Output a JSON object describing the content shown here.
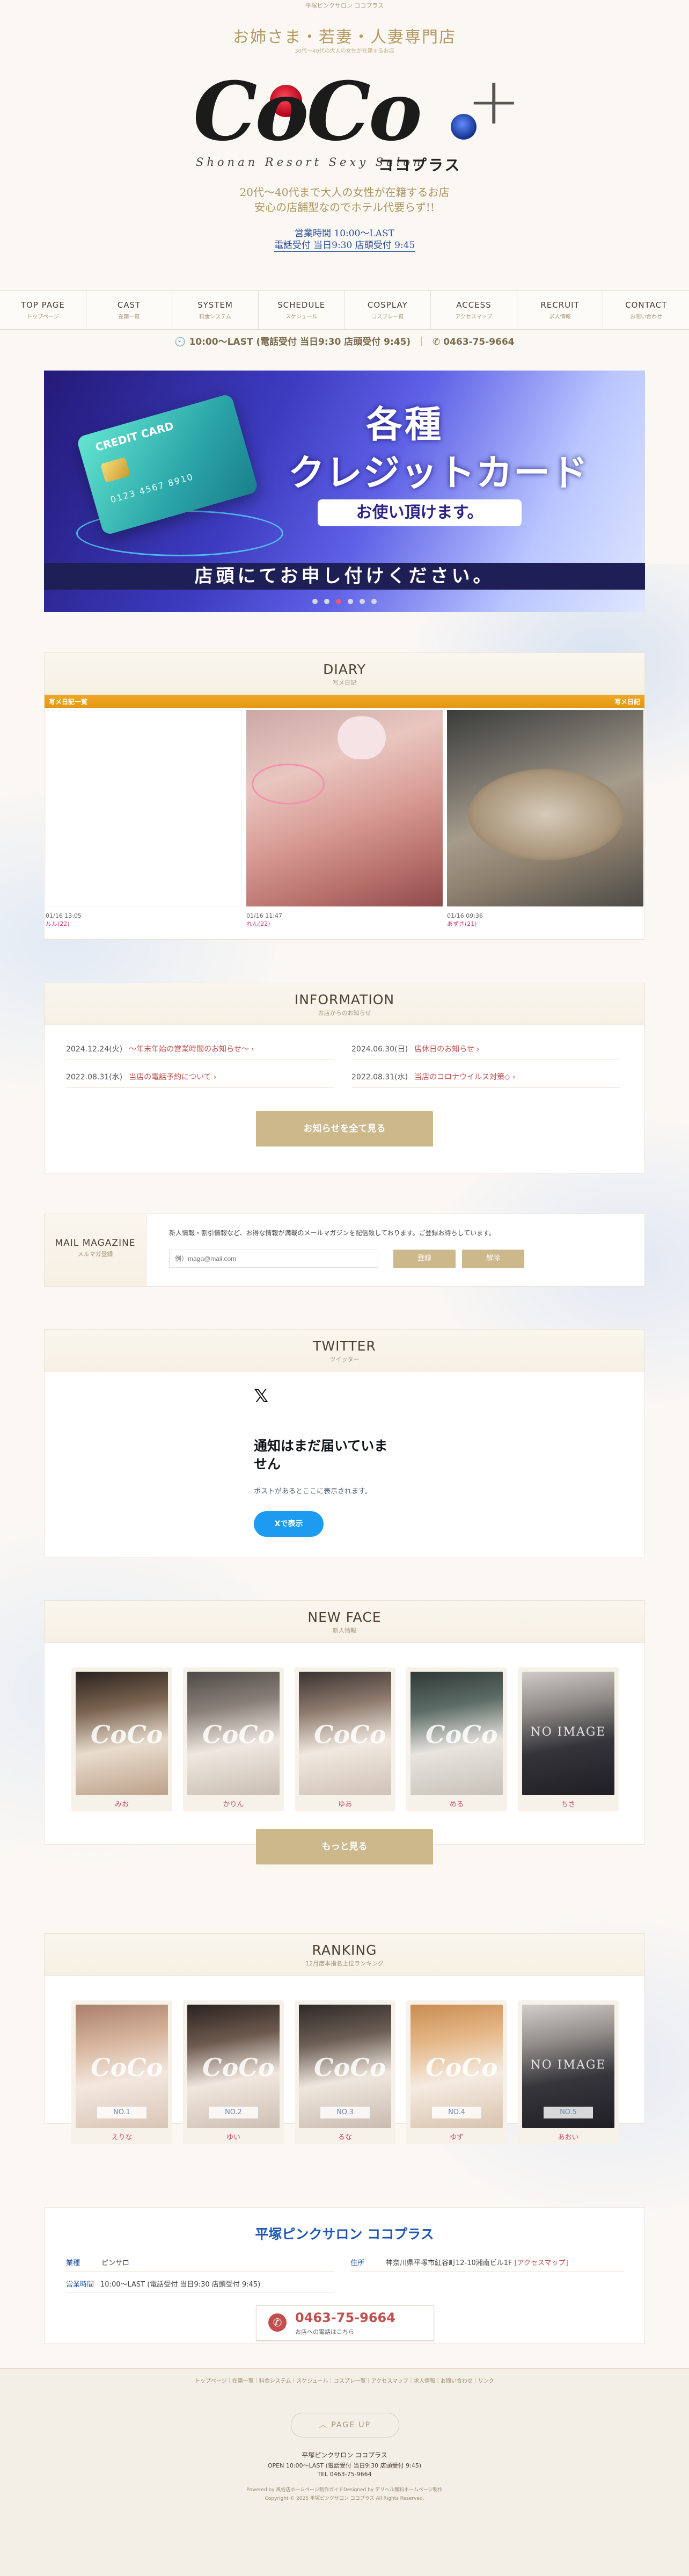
{
  "header": {
    "top_text": "平塚ピンクサロン ココプラス",
    "catchphrase": "お姉さま・若妻・人妻専門店",
    "catch_sub": "30代〜40代の大人の女性が在籍するお店",
    "logo_main": "CoCo",
    "logo_plus": "+",
    "logo_tagline": "Shonan Resort Sexy Salon",
    "logo_kana": "ココプラス",
    "lead_line1": "20代～40代まで大人の女性が在籍するお店",
    "lead_line2": "安心の店舗型なのでホテル代要らず!!",
    "hours_line1": "営業時間 10:00～LAST",
    "hours_line2": "電話受付 当日9:30 店頭受付 9:45"
  },
  "nav": [
    {
      "en": "TOP PAGE",
      "jp": "トップページ"
    },
    {
      "en": "CAST",
      "jp": "在籍一覧"
    },
    {
      "en": "SYSTEM",
      "jp": "料金システム"
    },
    {
      "en": "SCHEDULE",
      "jp": "スケジュール"
    },
    {
      "en": "COSPLAY",
      "jp": "コスプレ一覧"
    },
    {
      "en": "ACCESS",
      "jp": "アクセスマップ"
    },
    {
      "en": "RECRUIT",
      "jp": "求人情報"
    },
    {
      "en": "CONTACT",
      "jp": "お問い合わせ"
    }
  ],
  "infobar": {
    "hours": "10:00～LAST (電話受付 当日9:30 店頭受付 9:45)",
    "phone": "0463-75-9664"
  },
  "banner": {
    "card_title": "CREDIT CARD",
    "card_number": "0123 4567 8910",
    "line1": "各種",
    "line2": "クレジットカード",
    "line3": "お使い頂けます。",
    "bar": "店頭にてお申し付けください。",
    "active_slide": 3,
    "slides": 6
  },
  "diary": {
    "title_en": "DIARY",
    "title_jp": "写メ日記",
    "bar_left": "写メ日記一覧",
    "bar_right": "写メ日記",
    "entries": [
      {
        "date": "01/16 13:05",
        "name": "ルル(22)"
      },
      {
        "date": "01/16 11:47",
        "name": "れん(22)"
      },
      {
        "date": "01/16 09:36",
        "name": "あずさ(21)"
      }
    ]
  },
  "information": {
    "title_en": "INFORMATION",
    "title_jp": "お店からのお知らせ",
    "items": [
      {
        "date": "2024.12.24(火)",
        "text": "～年末年始の営業時間のお知らせ～"
      },
      {
        "date": "2024.06.30(日)",
        "text": "店休日のお知らせ"
      },
      {
        "date": "2022.08.31(水)",
        "text": "当店の電話予約について"
      },
      {
        "date": "2022.08.31(水)",
        "text": "当店のコロナウイルス対策◇"
      }
    ],
    "button": "お知らせを全て見る"
  },
  "mail": {
    "title_en": "MAIL MAGAZINE",
    "title_jp": "メルマガ登録",
    "text": "新人情報・割引情報など、お得な情報が満載のメールマガジンを配信致しております。ご登録お待ちしています。",
    "placeholder": "例）maga@mail.com",
    "subscribe": "登録",
    "unsubscribe": "解除"
  },
  "twitter": {
    "title_en": "TWITTER",
    "title_jp": "ツイッター",
    "logo": "𝕏",
    "heading_1": "通知はまだ届いていま",
    "heading_2": "せん",
    "sub": "ポストがあるとここに表示されます。",
    "button": "Xで表示"
  },
  "newface": {
    "title_en": "NEW FACE",
    "title_jp": "新人情報",
    "cast": [
      {
        "name": "みお"
      },
      {
        "name": "かりん"
      },
      {
        "name": "ゆあ"
      },
      {
        "name": "める"
      },
      {
        "name": "ちさ"
      }
    ],
    "button": "もっと見る"
  },
  "ranking": {
    "title_en": "RANKING",
    "title_jp": "12月度本指名上位ランキング",
    "cast": [
      {
        "rank": "NO.1",
        "name": "えりな"
      },
      {
        "rank": "NO.2",
        "name": "ゆい"
      },
      {
        "rank": "NO.3",
        "name": "るな"
      },
      {
        "rank": "NO.4",
        "name": "ゆず"
      },
      {
        "rank": "NO.5",
        "name": "あおい"
      }
    ]
  },
  "watermark": "CoCo",
  "no_image": "NO IMAGE",
  "shop": {
    "name": "平塚ピンクサロン ココプラス",
    "type_label": "業種",
    "type": "ピンサロ",
    "address_label": "住所",
    "address": "神奈川県平塚市紅谷町12-10湘南ビル1F",
    "address_link": "[アクセスマップ]",
    "hours_label": "営業時間",
    "hours": "10:00～LAST (電話受付 当日9:30 店頭受付 9:45)",
    "phone": "0463-75-9664",
    "phone_sub": "お店への電話はこちら"
  },
  "footer": {
    "links": "トップページ｜在籍一覧｜料金システム｜スケジュール｜コスプレ一覧｜アクセスマップ｜求人情報｜お問い合わせ｜リンク",
    "pageup": "PAGE UP",
    "name": "平塚ピンクサロン ココプラス",
    "open": "OPEN 10:00～LAST (電話受付 当日9:30 店頭受付 9:45)",
    "tel": "TEL 0463-75-9664",
    "powered": "Powered by 風俗店ホームページ制作ガイドDesigned by デリヘル無料ホームページ制作",
    "copyright": "Copyright © 2025 平塚ピンクサロン ココプラス All Rights Reserved."
  },
  "colors": {
    "accent_gold": "#cdb88c",
    "diary_orange": "#e49812",
    "link_red": "#c0504d",
    "shop_blue": "#1e57b8",
    "x_blue": "#1d9bf0"
  }
}
